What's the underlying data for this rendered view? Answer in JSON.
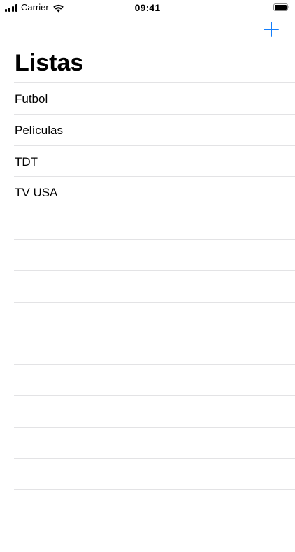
{
  "status_bar": {
    "carrier": "Carrier",
    "time": "09:41"
  },
  "nav_bar": {
    "add_icon": "plus-icon",
    "accent_color": "#147efb"
  },
  "page": {
    "title": "Listas"
  },
  "lists": [
    {
      "label": "Futbol"
    },
    {
      "label": "Películas"
    },
    {
      "label": "TDT"
    },
    {
      "label": "TV USA"
    }
  ],
  "empty_row_count": 10,
  "colors": {
    "separator": "#e3e3e5",
    "text": "#000000",
    "background": "#ffffff"
  }
}
